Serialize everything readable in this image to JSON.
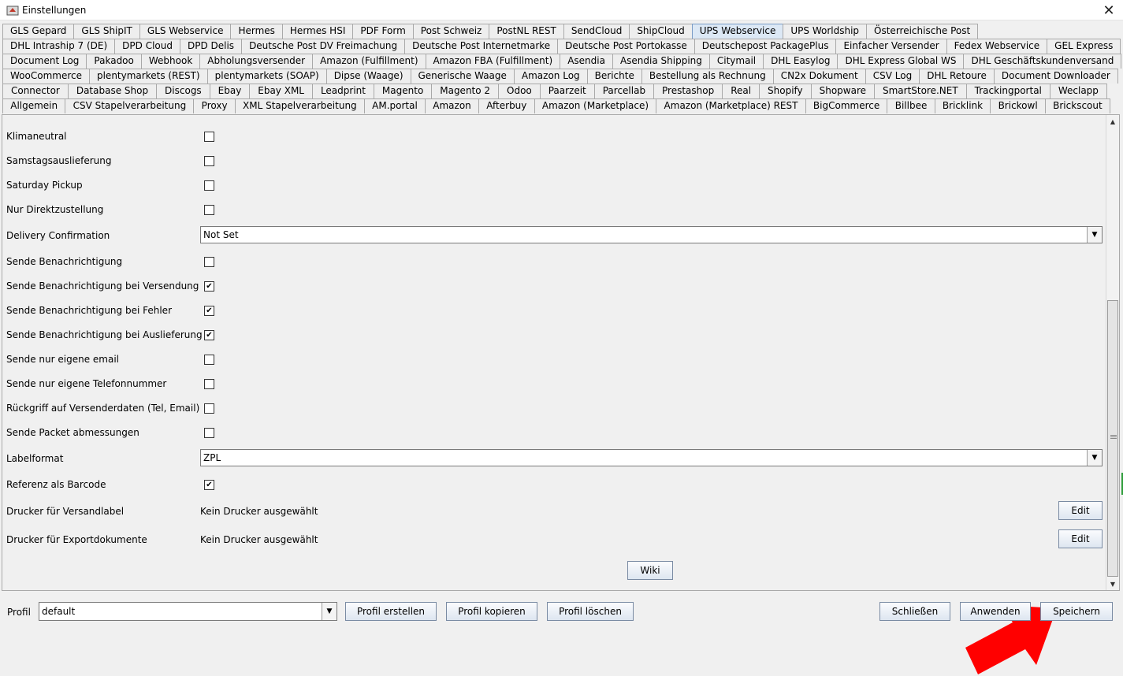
{
  "window": {
    "title": "Einstellungen",
    "close_label": "✕",
    "icon": "app-icon"
  },
  "tabs": {
    "row0": [
      "GLS Gepard",
      "GLS ShipIT",
      "GLS Webservice",
      "Hermes",
      "Hermes HSI",
      "PDF Form",
      "Post Schweiz",
      "PostNL REST",
      "SendCloud",
      "ShipCloud",
      "UPS Webservice",
      "UPS Worldship",
      "Österreichische Post"
    ],
    "row1": [
      "DHL Intraship 7 (DE)",
      "DPD Cloud",
      "DPD Delis",
      "Deutsche Post DV Freimachung",
      "Deutsche Post Internetmarke",
      "Deutsche Post Portokasse",
      "Deutschepost PackagePlus",
      "Einfacher Versender",
      "Fedex Webservice",
      "GEL Express"
    ],
    "row2": [
      "Document Log",
      "Pakadoo",
      "Webhook",
      "Abholungsversender",
      "Amazon (Fulfillment)",
      "Amazon FBA (Fulfillment)",
      "Asendia",
      "Asendia Shipping",
      "Citymail",
      "DHL Easylog",
      "DHL Express Global WS",
      "DHL Geschäftskundenversand"
    ],
    "row3": [
      "WooCommerce",
      "plentymarkets (REST)",
      "plentymarkets (SOAP)",
      "Dipse (Waage)",
      "Generische Waage",
      "Amazon Log",
      "Berichte",
      "Bestellung als Rechnung",
      "CN2x Dokument",
      "CSV Log",
      "DHL Retoure",
      "Document Downloader"
    ],
    "row4": [
      "Connector",
      "Database Shop",
      "Discogs",
      "Ebay",
      "Ebay XML",
      "Leadprint",
      "Magento",
      "Magento 2",
      "Odoo",
      "Paarzeit",
      "Parcellab",
      "Prestashop",
      "Real",
      "Shopify",
      "Shopware",
      "SmartStore.NET",
      "Trackingportal",
      "Weclapp"
    ],
    "row5": [
      "Allgemein",
      "CSV Stapelverarbeitung",
      "Proxy",
      "XML Stapelverarbeitung",
      "AM.portal",
      "Amazon",
      "Afterbuy",
      "Amazon (Marketplace)",
      "Amazon (Marketplace) REST",
      "BigCommerce",
      "Billbee",
      "Bricklink",
      "Brickowl",
      "Brickscout"
    ],
    "active_tab": "UPS Webservice"
  },
  "settings": {
    "klimaneutral": {
      "label": "Klimaneutral",
      "checked": false
    },
    "samstag": {
      "label": "Samstagsauslieferung",
      "checked": false
    },
    "saturday_pickup": {
      "label": "Saturday Pickup",
      "checked": false
    },
    "direktzustellung": {
      "label": "Nur Direktzustellung",
      "checked": false
    },
    "delivery_confirmation": {
      "label": "Delivery Confirmation",
      "value": "Not Set"
    },
    "benachrichtigung": {
      "label": "Sende Benachrichtigung",
      "checked": false
    },
    "benach_versendung": {
      "label": "Sende Benachrichtigung bei Versendung",
      "checked": true
    },
    "benach_fehler": {
      "label": "Sende Benachrichtigung bei Fehler",
      "checked": true
    },
    "benach_auslieferung": {
      "label": "Sende Benachrichtigung bei Auslieferung",
      "checked": true
    },
    "eigene_email": {
      "label": "Sende nur eigene email",
      "checked": false
    },
    "eigene_telefon": {
      "label": "Sende nur eigene Telefonnummer",
      "checked": false
    },
    "rueckgriff": {
      "label": "Rückgriff auf Versenderdaten (Tel, Email)",
      "checked": false
    },
    "packet_abmessungen": {
      "label": "Sende Packet abmessungen",
      "checked": false
    },
    "labelformat": {
      "label": "Labelformat",
      "value": "ZPL"
    },
    "referenz_barcode": {
      "label": "Referenz als Barcode",
      "checked": true
    },
    "drucker_versandlabel": {
      "label": "Drucker für Versandlabel",
      "value": "Kein Drucker ausgewählt",
      "button": "Edit"
    },
    "drucker_export": {
      "label": "Drucker für Exportdokumente",
      "value": "Kein Drucker ausgewählt",
      "button": "Edit"
    },
    "wiki_button": "Wiki"
  },
  "checkmark": "✔",
  "dropdown_glyph": "▼",
  "scroll_up_glyph": "▲",
  "scroll_down_glyph": "▼",
  "bottom": {
    "profile_label": "Profil",
    "profile_value": "default",
    "profil_erstellen": "Profil erstellen",
    "profil_kopieren": "Profil kopieren",
    "profil_loeschen": "Profil löschen",
    "schliessen": "Schließen",
    "anwenden": "Anwenden",
    "speichern": "Speichern"
  },
  "colors": {
    "active_tab": "#dce8f5",
    "annotation_arrow": "#ff0000",
    "button_border": "#7a8ba3"
  }
}
